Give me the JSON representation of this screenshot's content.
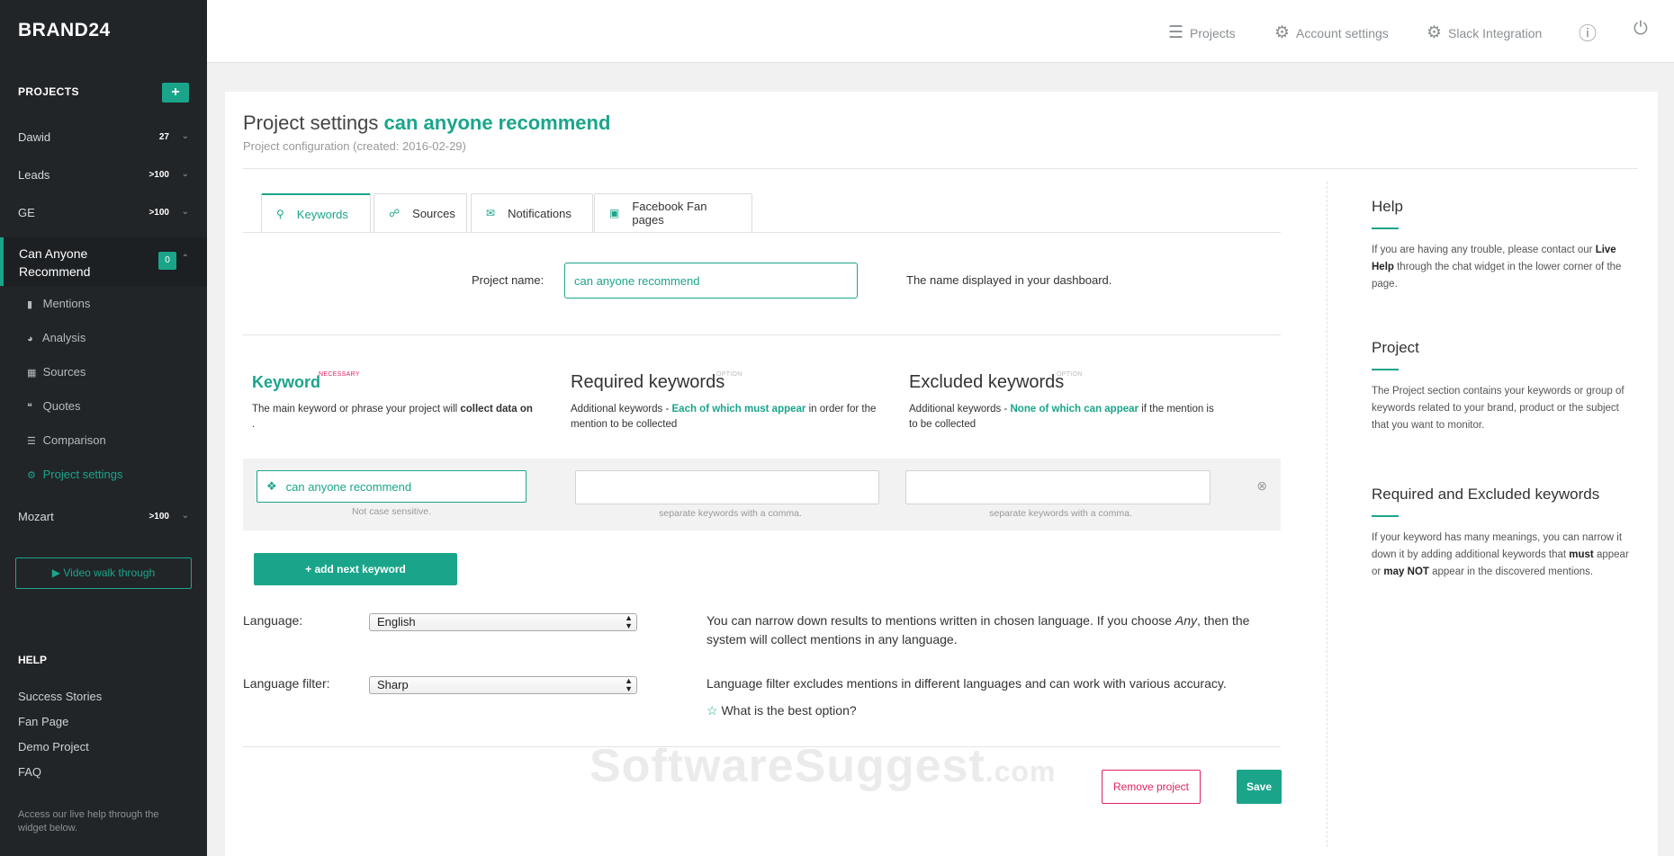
{
  "app": {
    "brand": "BRAND24"
  },
  "sidebar": {
    "projects_heading": "PROJECTS",
    "add_label": "+",
    "projects": [
      {
        "name": "Dawid",
        "count": "27"
      },
      {
        "name": "Leads",
        "count": ">100"
      },
      {
        "name": "GE",
        "count": ">100"
      }
    ],
    "active_project": {
      "name": "Can Anyone Recommend",
      "count": "0"
    },
    "sub_items": [
      {
        "label": "Mentions",
        "icon": "bar-chart-icon"
      },
      {
        "label": "Analysis",
        "icon": "pie-chart-icon"
      },
      {
        "label": "Sources",
        "icon": "briefcase-icon"
      },
      {
        "label": "Quotes",
        "icon": "quote-icon"
      },
      {
        "label": "Comparison",
        "icon": "list-icon"
      },
      {
        "label": "Project settings",
        "icon": "gears-icon"
      }
    ],
    "last_project": {
      "name": "Mozart",
      "count": ">100"
    },
    "video_button": "Video walk through",
    "help_heading": "HELP",
    "help_links": [
      "Success Stories",
      "Fan Page",
      "Demo Project",
      "FAQ"
    ],
    "help_note": "Access our live help through the widget below."
  },
  "topbar": {
    "projects": "Projects",
    "account_settings": "Account settings",
    "slack": "Slack Integration"
  },
  "page": {
    "title_prefix": "Project settings",
    "title_project": "can anyone recommend",
    "subtitle": "Project configuration (created: 2016-02-29)",
    "tabs": [
      "Keywords",
      "Sources",
      "Notifications",
      "Facebook Fan pages"
    ],
    "project_name_label": "Project name:",
    "project_name_value": "can anyone recommend",
    "project_name_hint": "The name displayed in your dashboard.",
    "keyword": {
      "title": "Keyword",
      "tag": "NECESSARY",
      "desc_1": "The main keyword or phrase your project will ",
      "desc_bold": "collect data on",
      "desc_2": "."
    },
    "required": {
      "title": "Required keywords",
      "tag": "OPTION",
      "desc_1": "Additional keywords - ",
      "desc_green": "Each of which must appear",
      "desc_2": " in order for the mention to be collected"
    },
    "excluded": {
      "title": "Excluded keywords",
      "tag": "OPTION",
      "desc_1": "Additional keywords - ",
      "desc_green": "None of which can appear",
      "desc_2": " if the mention is to be collected"
    },
    "keyword_value": "can anyone recommend",
    "not_case_sensitive": "Not case sensitive.",
    "separate_note": "separate keywords with a comma.",
    "add_next_keyword": "+ add next keyword",
    "language_label": "Language:",
    "language_value": "English",
    "language_desc_1": "You can narrow down results to mentions written in chosen language. If you choose ",
    "language_desc_any": "Any",
    "language_desc_2": ", then the system will collect mentions in any language.",
    "language_filter_label": "Language filter:",
    "language_filter_value": "Sharp",
    "language_filter_desc": "Language filter excludes mentions in different languages and can work with various accuracy.",
    "best_option": "What is the best option?",
    "remove_project": "Remove project",
    "save": "Save",
    "watermark": "SoftwareSuggest",
    "watermark_suffix": ".com"
  },
  "help_panel": {
    "help_title": "Help",
    "help_text_1": "If you are having any trouble, please contact our ",
    "help_text_bold": "Live Help",
    "help_text_2": " through the chat widget in the lower corner of the page.",
    "project_title": "Project",
    "project_text": "The Project section contains your keywords or group of keywords related to your brand, product or the subject that you want to monitor.",
    "req_title": "Required and Excluded keywords",
    "req_text_1": "If your keyword has many meanings, you can narrow it down it by adding additional keywords that ",
    "req_text_must": "must",
    "req_text_2": " appear or ",
    "req_text_maynot": "may NOT",
    "req_text_3": " appear in the discovered mentions."
  },
  "colors": {
    "accent": "#1aa58b",
    "sidebar_bg": "#222528",
    "danger": "#e0245e"
  }
}
